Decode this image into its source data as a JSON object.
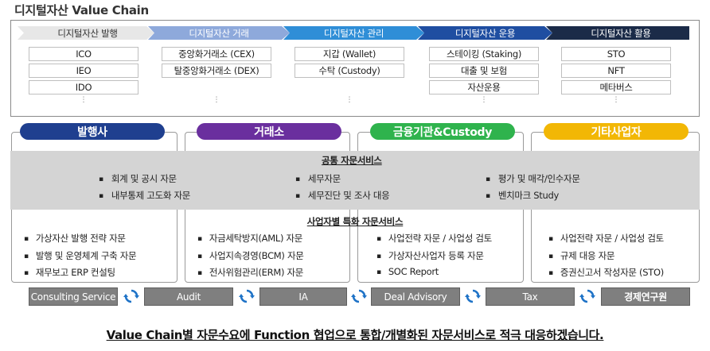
{
  "title": "디지털자산 Value Chain",
  "value_chain": [
    {
      "stage": "디지털자산 발행",
      "items": [
        "ICO",
        "IEO",
        "IDO"
      ]
    },
    {
      "stage": "디지털자산 거래",
      "items": [
        "중앙화거래소 (CEX)",
        "탈중앙화거래소 (DEX)"
      ]
    },
    {
      "stage": "디지털자산 관리",
      "items": [
        "지갑 (Wallet)",
        "수탁 (Custody)"
      ]
    },
    {
      "stage": "디지털자산 운용",
      "items": [
        "스테이킹 (Staking)",
        "대출 및 보험",
        "자산운용"
      ]
    },
    {
      "stage": "디지털자산 활용",
      "items": [
        "STO",
        "NFT",
        "메타버스"
      ]
    }
  ],
  "ellipsis": "⋮",
  "clients": [
    "발행사",
    "거래소",
    "금융기관&Custody",
    "기타사업자"
  ],
  "colors": {
    "chevrons": [
      "#e7e7e7",
      "#8ea9db",
      "#2f8ed7",
      "#1f4ea1",
      "#1b2b48"
    ],
    "clients": [
      "#1f3f8f",
      "#6a2f9e",
      "#2fb34d",
      "#f2b705"
    ],
    "service_bar": "#7f7f7f",
    "cycle_icon": "#1f73c7"
  },
  "common": {
    "heading": "공통 자문서비스",
    "items": [
      [
        "회계 및 공시 자문",
        "내부통제 고도화 자문"
      ],
      [
        "세무자문",
        "세무진단 및 조사 대응"
      ],
      [
        "평가 및 매각/인수자문",
        "벤치마크 Study"
      ]
    ]
  },
  "special": {
    "heading": "사업자별 특화 자문서비스",
    "columns": [
      [
        "가상자산 발행 전략 자문",
        "발행 및 운영체계 구축 자문",
        "재무보고 ERP 컨설팅"
      ],
      [
        "자금세탁방지(AML) 자문",
        "사업지속경영(BCM) 자문",
        "전사위험관리(ERM) 자문"
      ],
      [
        "사업전략 자문 / 사업성 검토",
        "가상자산사업자 등록 자문",
        "SOC Report"
      ],
      [
        "사업전략 자문 / 사업성 검토",
        "규제 대응 자문",
        "증권신고서 작성자문 (STO)"
      ]
    ]
  },
  "services": [
    "Consulting Service",
    "Audit",
    "IA",
    "Deal Advisory",
    "Tax",
    "경제연구원"
  ],
  "footer": "Value Chain별 자문수요에 Function 협업으로 통합/개별화된 자문서비스로 적극 대응하겠습니다."
}
